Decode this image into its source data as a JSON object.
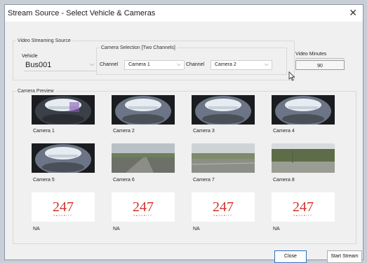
{
  "window": {
    "title": "Stream Source - Select Vehicle & Cameras",
    "close_glyph": "✕"
  },
  "source": {
    "legend": "Video Streaming Source",
    "vehicle_label": "Vehicle",
    "vehicle_value": "Bus001"
  },
  "camera_selection": {
    "legend": "Camera Selection [Two Channels]",
    "channel1_label": "Channel",
    "channel1_value": "Camera 1",
    "channel2_label": "Channel",
    "channel2_value": "Camera 2"
  },
  "video_minutes": {
    "label": "Video Minutes",
    "value": "90"
  },
  "preview": {
    "legend": "Camera Preview",
    "logo_text": "247",
    "logo_sub": "SECURITY",
    "logo_color": "#d0342c",
    "cameras": [
      {
        "label": "Camera 1",
        "kind": "fisheye-dark"
      },
      {
        "label": "Camera 2",
        "kind": "fisheye"
      },
      {
        "label": "Camera 3",
        "kind": "fisheye"
      },
      {
        "label": "Camera 4",
        "kind": "fisheye"
      },
      {
        "label": "Camera 5",
        "kind": "fisheye"
      },
      {
        "label": "Camera 6",
        "kind": "road"
      },
      {
        "label": "Camera 7",
        "kind": "road-side"
      },
      {
        "label": "Camera 8",
        "kind": "road-trees"
      },
      {
        "label": "NA",
        "kind": "logo"
      },
      {
        "label": "NA",
        "kind": "logo"
      },
      {
        "label": "NA",
        "kind": "logo"
      },
      {
        "label": "NA",
        "kind": "logo"
      }
    ]
  },
  "buttons": {
    "close": "Close",
    "start": "Start Stream"
  },
  "colors": {
    "accent": "#2f6fbf",
    "panel": "#f0f0f0"
  }
}
